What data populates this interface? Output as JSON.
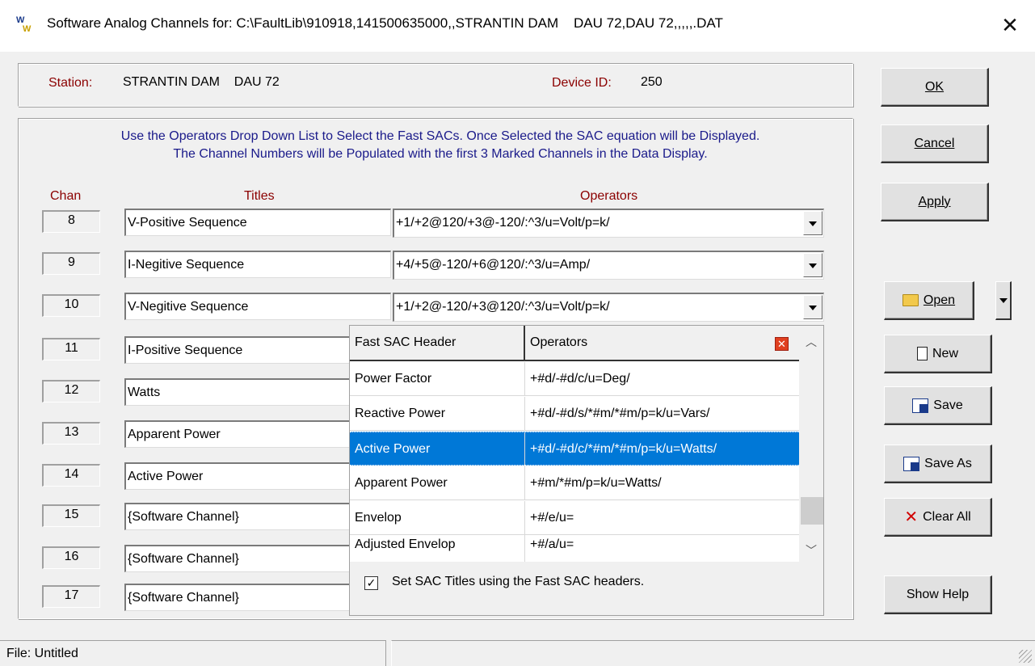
{
  "window": {
    "title": "Software Analog Channels for: C:\\FaultLib\\910918,141500635000,,STRANTIN DAM    DAU 72,DAU 72,,,,,.DAT",
    "icon_text_1": "W",
    "icon_text_2": "W",
    "close_glyph": "✕"
  },
  "station": {
    "label": "Station:",
    "value": "STRANTIN DAM    DAU 72",
    "device_label": "Device ID:",
    "device_value": "250"
  },
  "instructions": {
    "line1": "Use the Operators Drop Down List to Select the Fast SACs. Once Selected the SAC equation will be Displayed.",
    "line2": "The Channel Numbers will be Populated with the first 3 Marked Channels in the Data Display."
  },
  "headers": {
    "chan": "Chan",
    "titles": "Titles",
    "operators": "Operators"
  },
  "channels": [
    {
      "chan": "8",
      "title": "V-Positive Sequence",
      "operator": "+1/+2@120/+3@-120/:^3/u=Volt/p=k/"
    },
    {
      "chan": "9",
      "title": "I-Negitive Sequence",
      "operator": "+4/+5@-120/+6@120/:^3/u=Amp/"
    },
    {
      "chan": "10",
      "title": "V-Negitive Sequence",
      "operator": "+1/+2@-120/+3@120/:^3/u=Volt/p=k/"
    },
    {
      "chan": "11",
      "title": "I-Positive Sequence"
    },
    {
      "chan": "12",
      "title": "Watts"
    },
    {
      "chan": "13",
      "title": "Apparent Power"
    },
    {
      "chan": "14",
      "title": "Active Power"
    },
    {
      "chan": "15",
      "title": "{Software Channel}"
    },
    {
      "chan": "16",
      "title": "{Software Channel}"
    },
    {
      "chan": "17",
      "title": "{Software Channel}"
    }
  ],
  "fast_sac": {
    "col1": "Fast SAC Header",
    "col2": "Operators",
    "rows": [
      {
        "header": "Power Factor",
        "op": "+#d/-#d/c/u=Deg/"
      },
      {
        "header": "Reactive Power",
        "op": "+#d/-#d/s/*#m/*#m/p=k/u=Vars/"
      },
      {
        "header": "Active Power",
        "op": "+#d/-#d/c/*#m/*#m/p=k/u=Watts/"
      },
      {
        "header": "Apparent Power",
        "op": "+#m/*#m/p=k/u=Watts/"
      },
      {
        "header": "Envelop",
        "op": "+#/e/u="
      },
      {
        "header": "Adjusted Envelop",
        "op": "+#/a/u="
      }
    ],
    "selected_index": 2,
    "checkbox_label": "Set SAC Titles using the Fast SAC headers.",
    "checkbox_checked": true,
    "check_glyph": "✓"
  },
  "buttons": {
    "ok": "OK",
    "cancel": "Cancel",
    "apply": "Apply",
    "open": "Open",
    "new": "New",
    "save": "Save",
    "save_as": "Save As",
    "clear_all": "Clear All",
    "show_help": "Show Help"
  },
  "status": {
    "file": "File:  Untitled"
  },
  "colors": {
    "label_red": "#8b0000",
    "instr_blue": "#1a1a8a",
    "selection": "#0078d7"
  }
}
